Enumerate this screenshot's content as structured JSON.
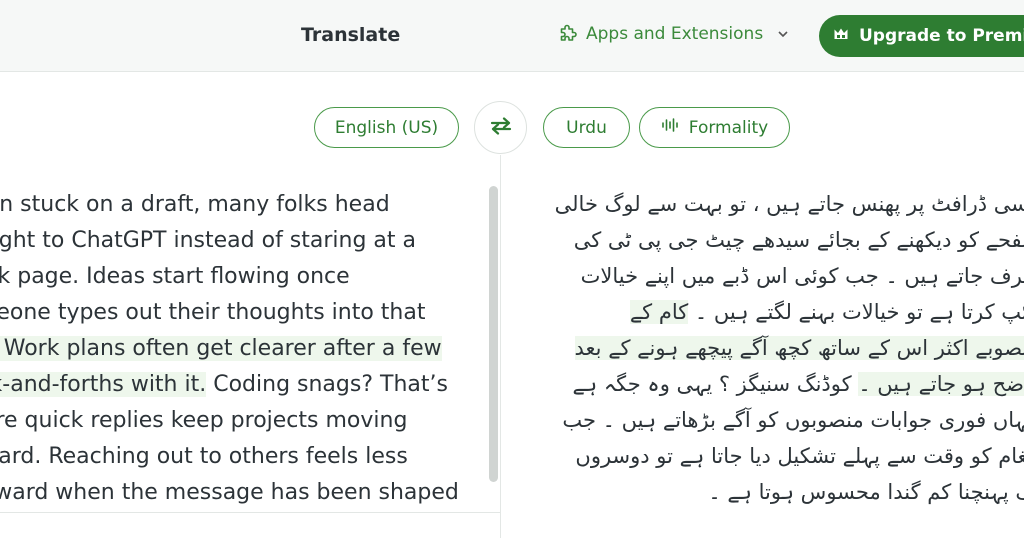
{
  "header": {
    "title": "Translate",
    "apps_label": "Apps and Extensions",
    "upgrade_label": "Upgrade to Premium"
  },
  "languages": {
    "source": "English (US)",
    "target": "Urdu",
    "formality": "Formality"
  },
  "source_text": [
    {
      "segments": [
        {
          "text": "When stuck on a draft, many folks head",
          "hl": false
        }
      ]
    },
    {
      "segments": [
        {
          "text": "straight to ChatGPT instead of staring at a",
          "hl": false
        }
      ]
    },
    {
      "segments": [
        {
          "text": "blank page. Ideas start flowing once",
          "hl": false
        }
      ]
    },
    {
      "segments": [
        {
          "text": "someone types out their thoughts into that",
          "hl": false
        }
      ]
    },
    {
      "segments": [
        {
          "text": "box. Work plans often get clearer after a few",
          "hl": true
        }
      ]
    },
    {
      "segments": [
        {
          "text": "back-and-forths with it.",
          "hl": true
        },
        {
          "text": " Coding snags? That’s",
          "hl": false
        }
      ]
    },
    {
      "segments": [
        {
          "text": "where quick replies keep projects moving",
          "hl": false
        }
      ]
    },
    {
      "segments": [
        {
          "text": "forward. Reaching out to others feels less",
          "hl": false
        }
      ]
    },
    {
      "segments": [
        {
          "text": "awkward when the message has been shaped",
          "hl": false
        }
      ]
    }
  ],
  "target_text": [
    {
      "segments": [
        {
          "text": "کسی ڈرافٹ پر پھنس جاتے ہیں ، تو بہت سے لوگ خالی",
          "hl": false
        }
      ]
    },
    {
      "segments": [
        {
          "text": "صفحے کو دیکھنے کے بجائے سیدھے چیٹ جی پی ٹی کی",
          "hl": false
        }
      ]
    },
    {
      "segments": [
        {
          "text": "طرف جاتے ہیں ۔ جب کوئی اس ڈبے میں اپنے خیالات",
          "hl": false
        }
      ]
    },
    {
      "segments": [
        {
          "text": "ٹائپ کرتا ہے تو خیالات بہنے لگتے ہیں ۔ ",
          "hl": false
        },
        {
          "text": "کام کے",
          "hl": true
        }
      ]
    },
    {
      "segments": [
        {
          "text": "منصوبے اکثر اس کے ساتھ کچھ آگے پیچھے ہونے کے بعد",
          "hl": true
        }
      ]
    },
    {
      "segments": [
        {
          "text": "واضح ہو جاتے ہیں ۔",
          "hl": true
        },
        {
          "text": " کوڈنگ سنیگز ؟ یہی وہ جگہ ہے",
          "hl": false
        }
      ]
    },
    {
      "segments": [
        {
          "text": "جہاں فوری جوابات منصوبوں کو آگے بڑھاتے ہیں ۔ جب",
          "hl": false
        }
      ]
    },
    {
      "segments": [
        {
          "text": "پیغام کو وقت سے پہلے تشکیل دیا جاتا ہے تو دوسروں",
          "hl": false
        }
      ]
    },
    {
      "segments": [
        {
          "text": "تک پہنچنا کم گندا محسوس ہوتا ہے ۔",
          "hl": false
        }
      ]
    }
  ],
  "colors": {
    "accent": "#2e7d32",
    "highlight": "#eef7ec",
    "topbar_bg": "#f6f8f7"
  },
  "icons": [
    "puzzle-icon",
    "chevron-down-icon",
    "crown-icon",
    "swap-arrows-icon",
    "soundwave-icon"
  ]
}
